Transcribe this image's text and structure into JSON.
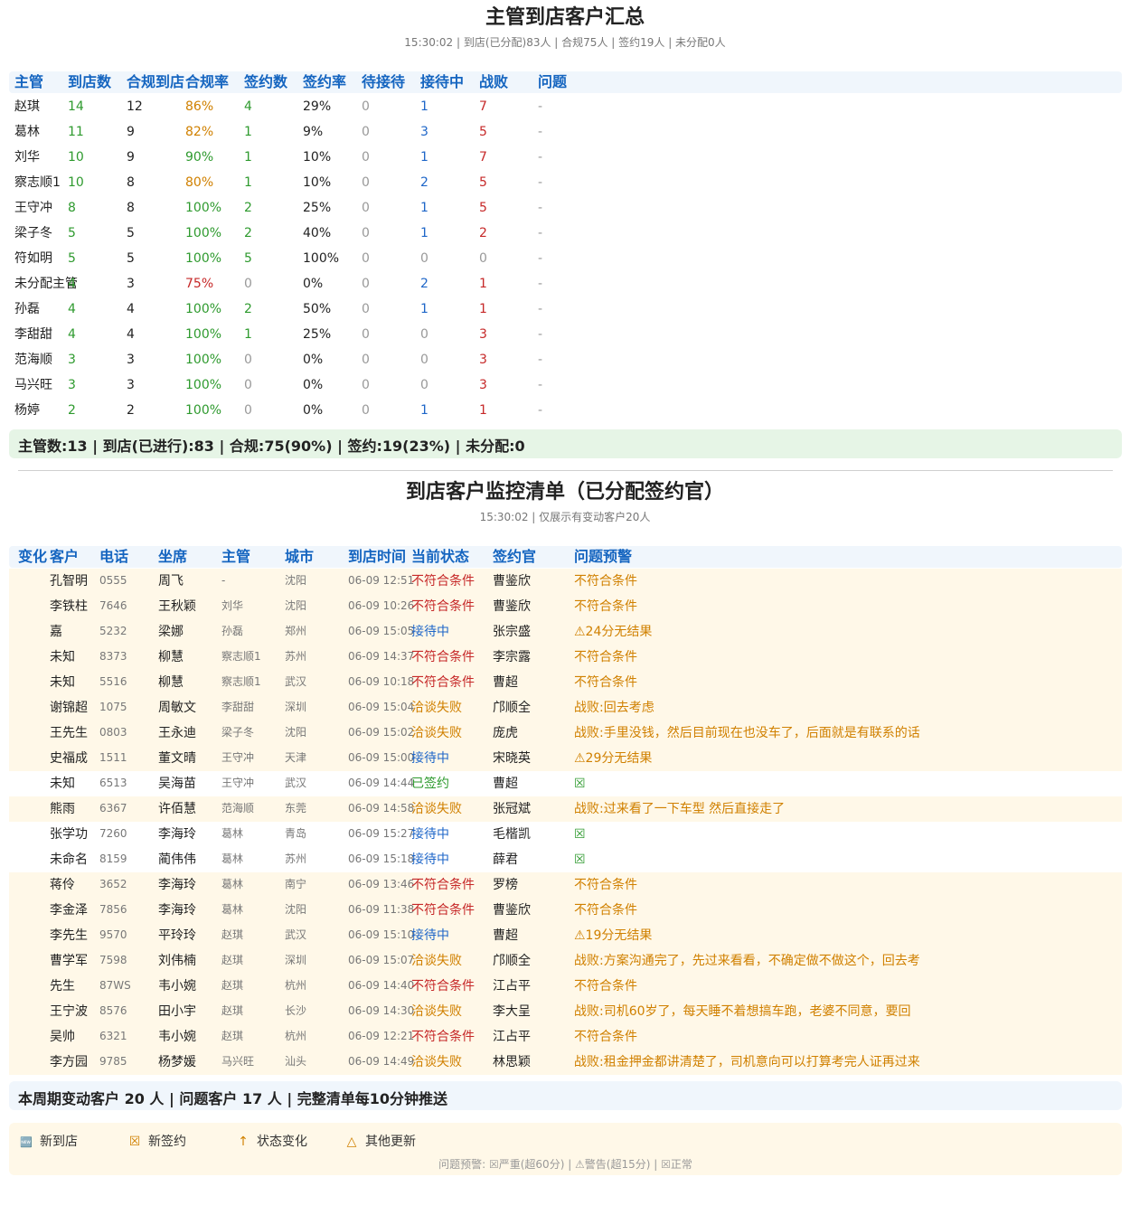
{
  "summary": {
    "title": "主管到店客户汇总",
    "subtitle": "15:30:02 | 到店(已分配)83人 | 合规75人 | 签约19人 | 未分配0人",
    "headers": [
      "主管",
      "到店数",
      "合规到店",
      "合规率",
      "签约数",
      "签约率",
      "待接待",
      "接待中",
      "战败",
      "问题"
    ],
    "rows": [
      [
        "赵琪",
        "14",
        "12",
        "86%",
        "4",
        "29%",
        "0",
        "1",
        "7",
        "-"
      ],
      [
        "葛林",
        "11",
        "9",
        "82%",
        "1",
        "9%",
        "0",
        "3",
        "5",
        "-"
      ],
      [
        "刘华",
        "10",
        "9",
        "90%",
        "1",
        "10%",
        "0",
        "1",
        "7",
        "-"
      ],
      [
        "察志顺1",
        "10",
        "8",
        "80%",
        "1",
        "10%",
        "0",
        "2",
        "5",
        "-"
      ],
      [
        "王守冲",
        "8",
        "8",
        "100%",
        "2",
        "25%",
        "0",
        "1",
        "5",
        "-"
      ],
      [
        "梁子冬",
        "5",
        "5",
        "100%",
        "2",
        "40%",
        "0",
        "1",
        "2",
        "-"
      ],
      [
        "符如明",
        "5",
        "5",
        "100%",
        "5",
        "100%",
        "0",
        "0",
        "0",
        "-"
      ],
      [
        "未分配主管",
        "4",
        "3",
        "75%",
        "0",
        "0%",
        "0",
        "2",
        "1",
        "-"
      ],
      [
        "孙磊",
        "4",
        "4",
        "100%",
        "2",
        "50%",
        "0",
        "1",
        "1",
        "-"
      ],
      [
        "李甜甜",
        "4",
        "4",
        "100%",
        "1",
        "25%",
        "0",
        "0",
        "3",
        "-"
      ],
      [
        "范海顺",
        "3",
        "3",
        "100%",
        "0",
        "0%",
        "0",
        "0",
        "3",
        "-"
      ],
      [
        "马兴旺",
        "3",
        "3",
        "100%",
        "0",
        "0%",
        "0",
        "0",
        "3",
        "-"
      ],
      [
        "杨婷",
        "2",
        "2",
        "100%",
        "0",
        "0%",
        "0",
        "1",
        "1",
        "-"
      ]
    ],
    "total": "主管数:13 | 到店(已进行):83 | 合规:75(90%) | 签约:19(23%) | 未分配:0"
  },
  "monitor": {
    "title": "到店客户监控清单（已分配签约官）",
    "subtitle": "15:30:02 | 仅展示有变动客户20人",
    "headers": [
      "变化",
      "客户",
      "电话",
      "坐席",
      "主管",
      "城市",
      "到店时间",
      "当前状态",
      "签约官",
      "问题预警"
    ],
    "rows": [
      {
        "change": "",
        "customer": "孔智明",
        "phone": "0555",
        "agent": "周飞",
        "manager": "-",
        "city": "沈阳",
        "time": "06-09 12:51",
        "status": "不符合条件",
        "signer": "曹鉴欣",
        "alert": "不符合条件",
        "hl": true
      },
      {
        "change": "",
        "customer": "李铁柱",
        "phone": "7646",
        "agent": "王秋颖",
        "manager": "刘华",
        "city": "沈阳",
        "time": "06-09 10:26",
        "status": "不符合条件",
        "signer": "曹鉴欣",
        "alert": "不符合条件",
        "hl": true
      },
      {
        "change": "",
        "customer": "嘉",
        "phone": "5232",
        "agent": "梁娜",
        "manager": "孙磊",
        "city": "郑州",
        "time": "06-09 15:05",
        "status": "接待中",
        "signer": "张宗盛",
        "alert": "⚠24分无结果",
        "hl": true
      },
      {
        "change": "",
        "customer": "未知",
        "phone": "8373",
        "agent": "柳慧",
        "manager": "察志顺1",
        "city": "苏州",
        "time": "06-09 14:37",
        "status": "不符合条件",
        "signer": "李宗露",
        "alert": "不符合条件",
        "hl": true
      },
      {
        "change": "",
        "customer": "未知",
        "phone": "5516",
        "agent": "柳慧",
        "manager": "察志顺1",
        "city": "武汉",
        "time": "06-09 10:18",
        "status": "不符合条件",
        "signer": "曹超",
        "alert": "不符合条件",
        "hl": true
      },
      {
        "change": "",
        "customer": "谢锦超",
        "phone": "1075",
        "agent": "周敏文",
        "manager": "李甜甜",
        "city": "深圳",
        "time": "06-09 15:04",
        "status": "洽谈失败",
        "signer": "邝顺全",
        "alert": "战败:回去考虑",
        "hl": true
      },
      {
        "change": "",
        "customer": "王先生",
        "phone": "0803",
        "agent": "王永迪",
        "manager": "梁子冬",
        "city": "沈阳",
        "time": "06-09 15:02",
        "status": "洽谈失败",
        "signer": "庞虎",
        "alert": "战败:手里没钱，然后目前现在也没车了，后面就是有联系的话",
        "hl": true
      },
      {
        "change": "",
        "customer": "史福成",
        "phone": "1511",
        "agent": "董文晴",
        "manager": "王守冲",
        "city": "天津",
        "time": "06-09 15:00",
        "status": "接待中",
        "signer": "宋晓英",
        "alert": "⚠29分无结果",
        "hl": true
      },
      {
        "change": "",
        "customer": "未知",
        "phone": "6513",
        "agent": "吴海苗",
        "manager": "王守冲",
        "city": "武汉",
        "time": "06-09 14:44",
        "status": "已签约",
        "signer": "曹超",
        "alert": "☒",
        "hl": false
      },
      {
        "change": "",
        "customer": "熊雨",
        "phone": "6367",
        "agent": "许佰慧",
        "manager": "范海顺",
        "city": "东莞",
        "time": "06-09 14:58",
        "status": "洽谈失败",
        "signer": "张冠斌",
        "alert": "战败:过来看了一下车型 然后直接走了",
        "hl": true
      },
      {
        "change": "",
        "customer": "张学功",
        "phone": "7260",
        "agent": "李海玲",
        "manager": "葛林",
        "city": "青岛",
        "time": "06-09 15:27",
        "status": "接待中",
        "signer": "毛楷凯",
        "alert": "☒",
        "hl": false
      },
      {
        "change": "",
        "customer": "未命名",
        "phone": "8159",
        "agent": "蔺伟伟",
        "manager": "葛林",
        "city": "苏州",
        "time": "06-09 15:18",
        "status": "接待中",
        "signer": "薛君",
        "alert": "☒",
        "hl": false
      },
      {
        "change": "",
        "customer": "蒋伶",
        "phone": "3652",
        "agent": "李海玲",
        "manager": "葛林",
        "city": "南宁",
        "time": "06-09 13:46",
        "status": "不符合条件",
        "signer": "罗榜",
        "alert": "不符合条件",
        "hl": true
      },
      {
        "change": "",
        "customer": "李金泽",
        "phone": "7856",
        "agent": "李海玲",
        "manager": "葛林",
        "city": "沈阳",
        "time": "06-09 11:38",
        "status": "不符合条件",
        "signer": "曹鉴欣",
        "alert": "不符合条件",
        "hl": true
      },
      {
        "change": "",
        "customer": "李先生",
        "phone": "9570",
        "agent": "平玲玲",
        "manager": "赵琪",
        "city": "武汉",
        "time": "06-09 15:10",
        "status": "接待中",
        "signer": "曹超",
        "alert": "⚠19分无结果",
        "hl": true
      },
      {
        "change": "",
        "customer": "曹学军",
        "phone": "7598",
        "agent": "刘伟楠",
        "manager": "赵琪",
        "city": "深圳",
        "time": "06-09 15:07",
        "status": "洽谈失败",
        "signer": "邝顺全",
        "alert": "战败:方案沟通完了，先过来看看，不确定做不做这个，回去考",
        "hl": true
      },
      {
        "change": "",
        "customer": "先生",
        "phone": "87WS",
        "agent": "韦小婉",
        "manager": "赵琪",
        "city": "杭州",
        "time": "06-09 14:40",
        "status": "不符合条件",
        "signer": "江占平",
        "alert": "不符合条件",
        "hl": true
      },
      {
        "change": "",
        "customer": "王宁波",
        "phone": "8576",
        "agent": "田小宇",
        "manager": "赵琪",
        "city": "长沙",
        "time": "06-09 14:30",
        "status": "洽谈失败",
        "signer": "李大呈",
        "alert": "战败:司机60岁了，每天睡不着想搞车跑，老婆不同意，要回",
        "hl": true
      },
      {
        "change": "",
        "customer": "吴帅",
        "phone": "6321",
        "agent": "韦小婉",
        "manager": "赵琪",
        "city": "杭州",
        "time": "06-09 12:21",
        "status": "不符合条件",
        "signer": "江占平",
        "alert": "不符合条件",
        "hl": true
      },
      {
        "change": "",
        "customer": "李方园",
        "phone": "9785",
        "agent": "杨梦媛",
        "manager": "马兴旺",
        "city": "汕头",
        "time": "06-09 14:49",
        "status": "洽谈失败",
        "signer": "林思颖",
        "alert": "战败:租金押金都讲清楚了，司机意向可以打算考完人证再过来",
        "hl": true
      }
    ],
    "footer": "本周期变动客户 20 人 | 问题客户 17 人 | 完整清单每10分钟推送"
  },
  "legend": {
    "items": [
      {
        "icon": "🆕",
        "icon_name": "new-badge-icon",
        "label": "新到店"
      },
      {
        "icon": "☒",
        "icon_name": "signed-box-icon",
        "label": "新签约"
      },
      {
        "icon": "↑",
        "icon_name": "up-arrow-icon",
        "label": "状态变化"
      },
      {
        "icon": "△",
        "icon_name": "triangle-icon",
        "label": "其他更新"
      }
    ],
    "note": "问题预警: ☒严重(超60分) | ⚠警告(超15分) | ☒正常"
  },
  "colors": {
    "header_blue": "#1565c0",
    "green": "#2e9a2e",
    "orange": "#d08000",
    "red": "#c62828",
    "blue": "#1e66c8"
  }
}
